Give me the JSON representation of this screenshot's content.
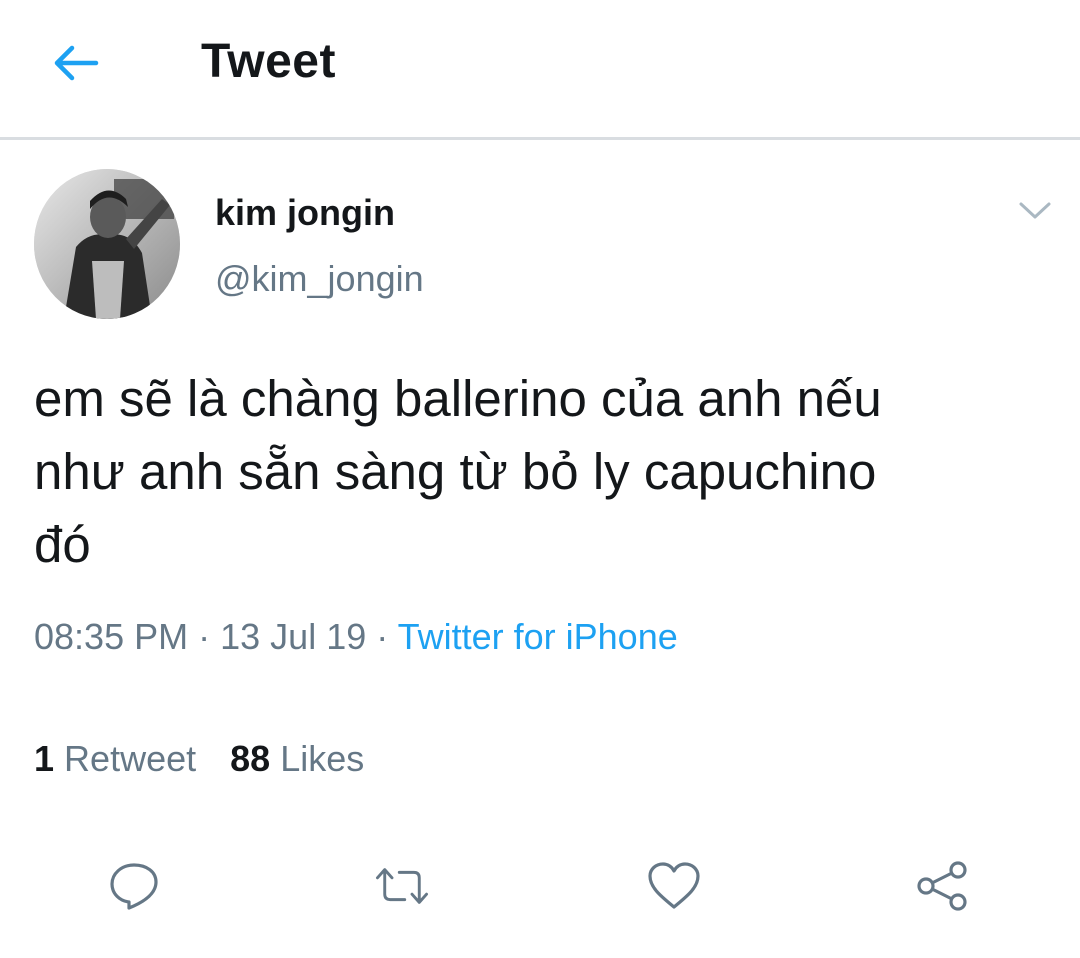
{
  "header": {
    "title": "Tweet",
    "back_icon": "arrow-left-icon",
    "accent_color": "#1da1f2"
  },
  "tweet": {
    "author": {
      "display_name": "kim jongin",
      "handle": "@kim_jongin"
    },
    "text": "em sẽ là chàng ballerino của anh nếu\nnhư anh sẵn sàng từ bỏ ly capuchino\nđó",
    "time": "08:35 PM",
    "separator": "·",
    "date": "13 Jul 19",
    "source": "Twitter for iPhone",
    "stats": {
      "retweets_count": "1",
      "retweets_label": "Retweet",
      "likes_count": "88",
      "likes_label": "Likes"
    },
    "actions": [
      "reply-icon",
      "retweet-icon",
      "like-icon",
      "share-icon"
    ]
  }
}
